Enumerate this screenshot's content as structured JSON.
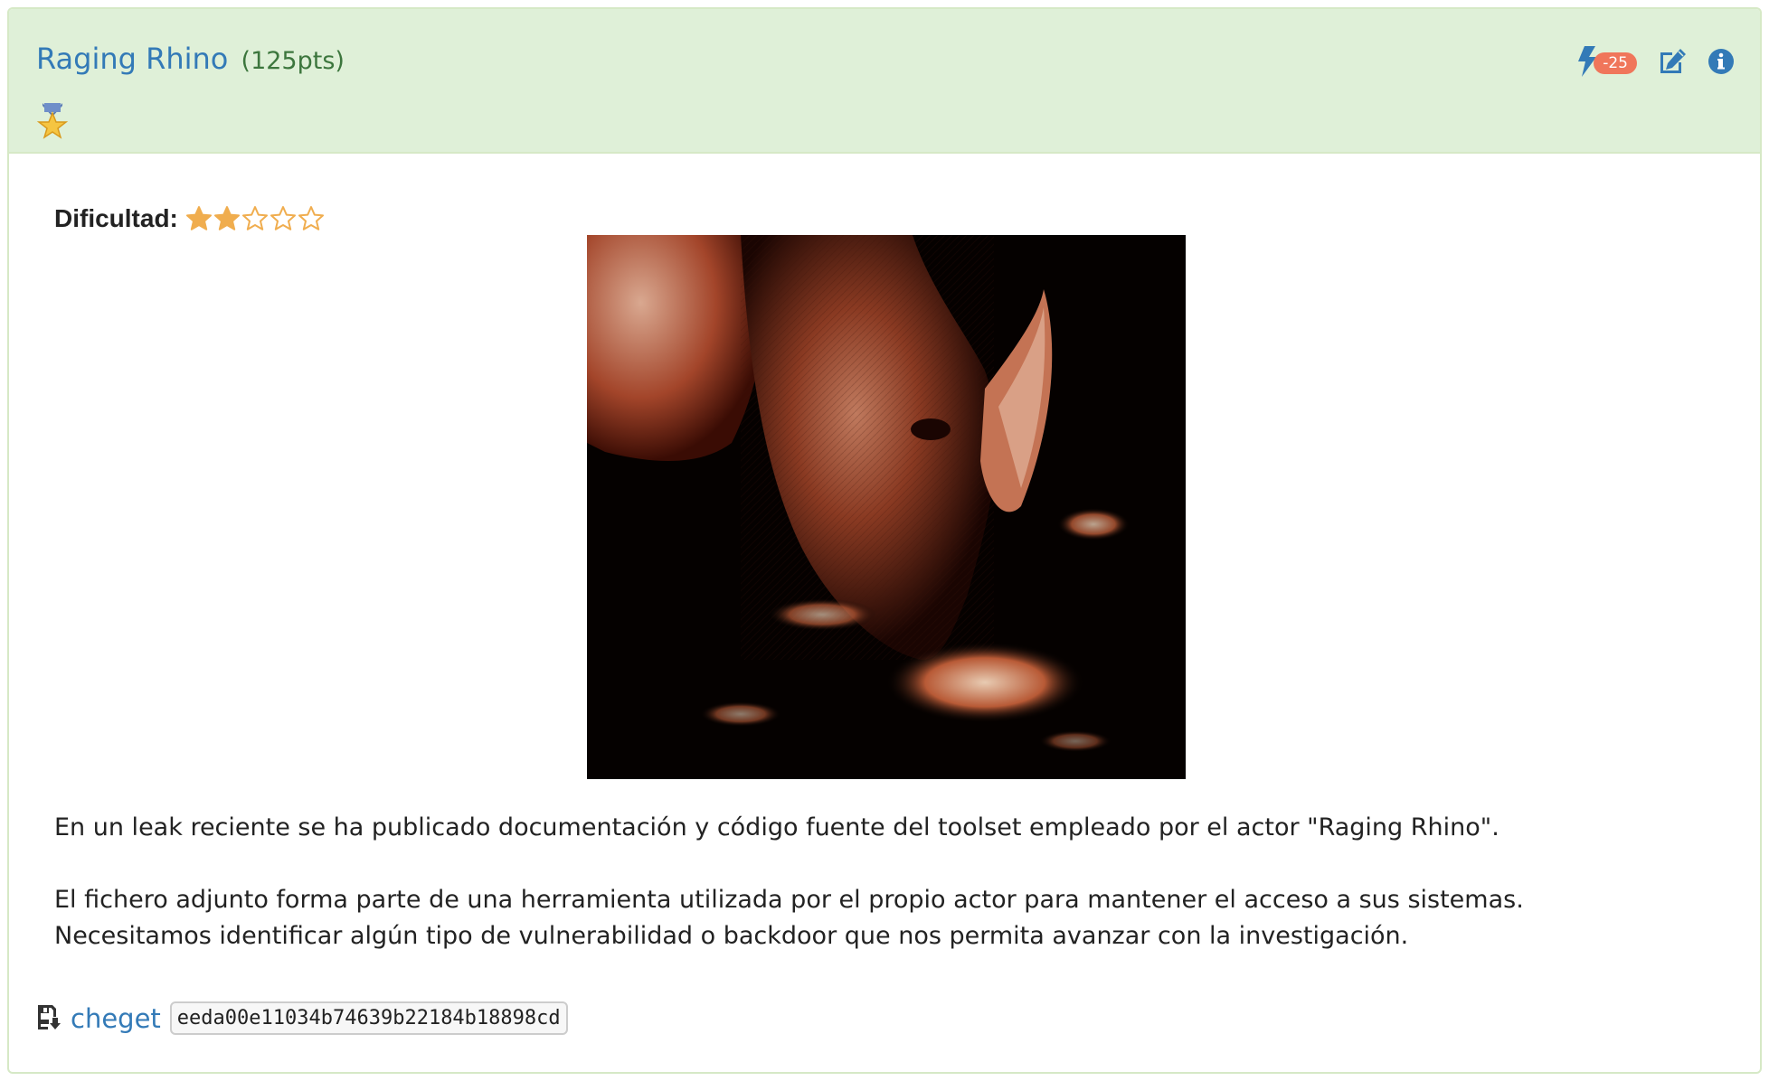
{
  "challenge": {
    "title": "Raging Rhino",
    "points": "(125pts)",
    "penalty_badge": "-25",
    "icons": {
      "medal": "medal-star-icon",
      "hint": "bolt-icon",
      "edit": "edit-icon",
      "info": "info-circle-icon"
    }
  },
  "difficulty": {
    "label": "Dificultad:",
    "rating": 2,
    "max": 5
  },
  "description": {
    "paragraph1": "En un leak reciente se ha publicado documentación y código fuente del toolset empleado por el actor \"Raging Rhino\".",
    "paragraph2_line1": "El fichero adjunto forma parte de una herramienta utilizada por el propio actor para mantener el acceso a sus sistemas.",
    "paragraph2_line2": "Necesitamos identificar algún tipo de vulnerabilidad o backdoor que nos permita avanzar con la investigación."
  },
  "attachment": {
    "icon": "file-download-icon",
    "filename": "cheget",
    "hash": "eeda00e11034b74639b22184b18898cd"
  },
  "colors": {
    "heading_bg": "#dff0d8",
    "link": "#337ab7",
    "points": "#3c763d",
    "badge": "#f0765b",
    "star": "#f0ad4e"
  }
}
